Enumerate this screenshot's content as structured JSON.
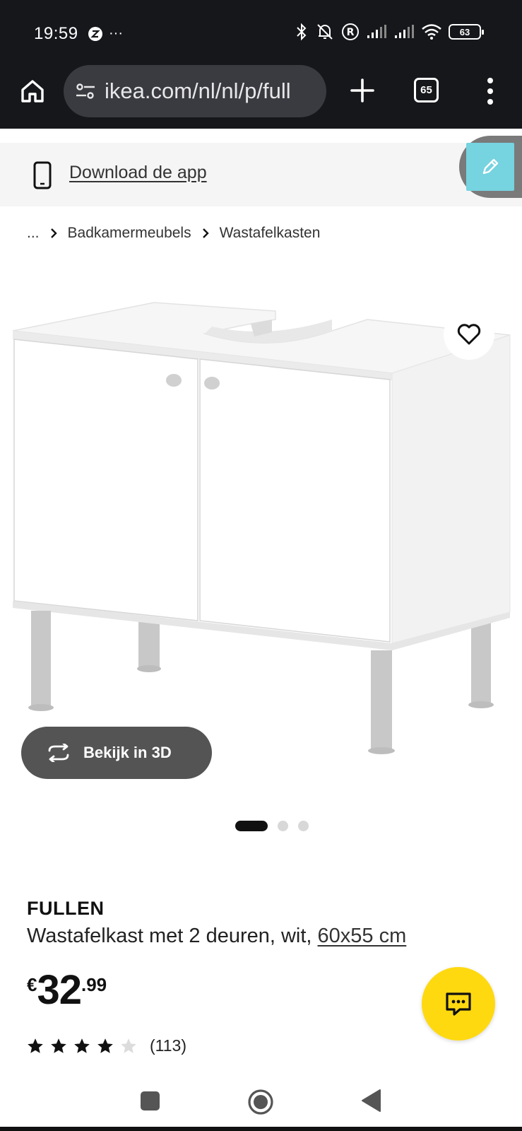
{
  "status_bar": {
    "time": "19:59",
    "dots": "···",
    "battery": "63"
  },
  "browser": {
    "url": "ikea.com/nl/nl/p/full",
    "tab_count": "65"
  },
  "app_banner": {
    "label": "Download de app"
  },
  "breadcrumb": {
    "ellipsis": "...",
    "items": [
      "Badkamermeubels",
      "Wastafelkasten"
    ]
  },
  "gallery": {
    "view_3d_label": "Bekijk in 3D",
    "image_count": 3,
    "active_index": 0
  },
  "product": {
    "name": "FULLEN",
    "description": "Wastafelkast met 2 deuren, wit, ",
    "size": "60x55 cm",
    "price_currency": "€",
    "price_integer": "32",
    "price_decimal": ".99",
    "rating": 4,
    "rating_max": 5,
    "review_count": "(113)"
  },
  "colors": {
    "status_bg": "#16171b",
    "chat_fab": "#ffd910",
    "edit_fab": "#76d3e0",
    "view3d_bg": "#545454"
  }
}
